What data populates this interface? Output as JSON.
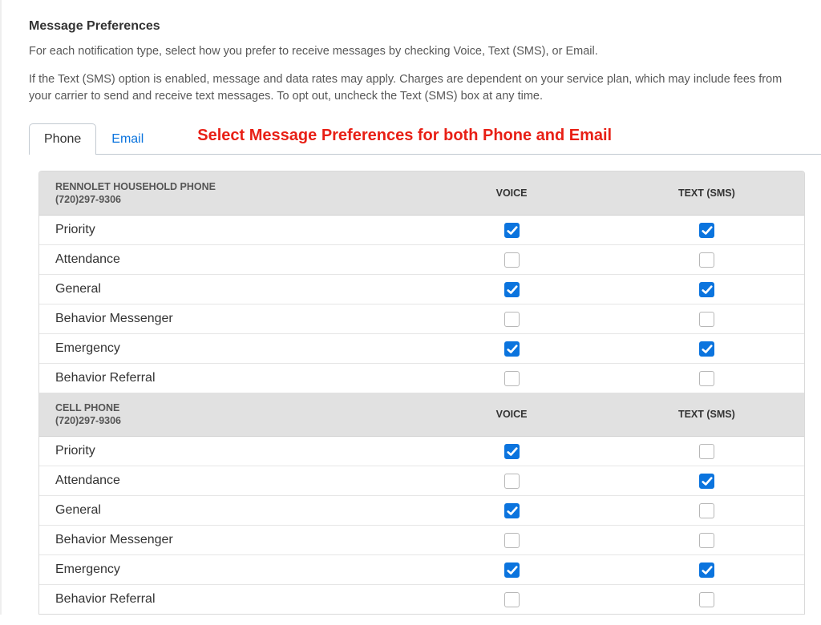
{
  "section": {
    "title": "Message Preferences",
    "p1": "For each notification type, select how you prefer to receive messages by checking Voice, Text (SMS), or Email.",
    "p2": "If the Text (SMS) option is enabled, message and data rates may apply. Charges are dependent on your service plan, which may include fees from your carrier to send and receive text messages. To opt out, uncheck the Text (SMS) box at any time."
  },
  "tabs": {
    "phone": "Phone",
    "email": "Email",
    "instruction": "Select Message Preferences for both Phone and Email"
  },
  "columns": {
    "voice": "VOICE",
    "text": "TEXT (SMS)"
  },
  "sections": [
    {
      "title": "RENNOLET HOUSEHOLD PHONE",
      "subtitle": "(720)297-9306",
      "rows": [
        {
          "label": "Priority",
          "voice": true,
          "text": true
        },
        {
          "label": "Attendance",
          "voice": false,
          "text": false
        },
        {
          "label": "General",
          "voice": true,
          "text": true
        },
        {
          "label": "Behavior Messenger",
          "voice": false,
          "text": false
        },
        {
          "label": "Emergency",
          "voice": true,
          "text": true
        },
        {
          "label": "Behavior Referral",
          "voice": false,
          "text": false
        }
      ]
    },
    {
      "title": "CELL PHONE",
      "subtitle": "(720)297-9306",
      "rows": [
        {
          "label": "Priority",
          "voice": true,
          "text": false
        },
        {
          "label": "Attendance",
          "voice": false,
          "text": true
        },
        {
          "label": "General",
          "voice": true,
          "text": false
        },
        {
          "label": "Behavior Messenger",
          "voice": false,
          "text": false
        },
        {
          "label": "Emergency",
          "voice": true,
          "text": true
        },
        {
          "label": "Behavior Referral",
          "voice": false,
          "text": false
        }
      ]
    }
  ]
}
